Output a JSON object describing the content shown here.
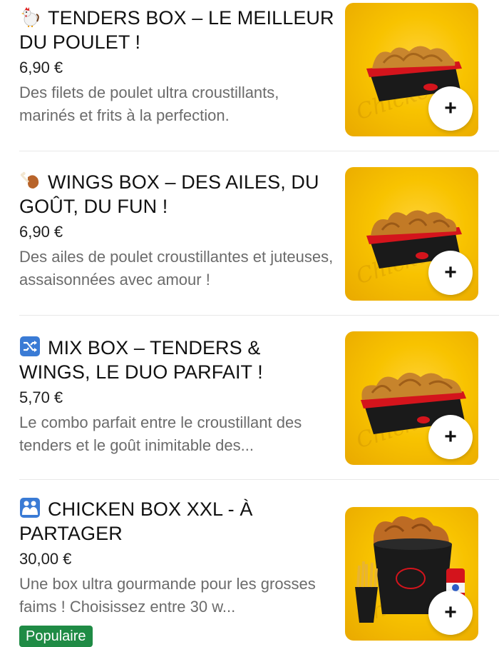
{
  "items": [
    {
      "title": "TENDERS BOX – LE MEILLEUR DU POULET !",
      "emoji": "rooster-emoji",
      "price": "6,90 €",
      "description": "Des filets de poulet ultra croustillants, marinés et frits à la perfection.",
      "image": "tenders-box-photo",
      "add_label": "+"
    },
    {
      "title": "WINGS BOX – DES AILES, DU GOÛT, DU FUN !",
      "emoji": "drumstick-emoji",
      "price": "6,90 €",
      "description": "Des ailes de poulet croustillantes et juteuses, assaisonnées avec amour !",
      "image": "wings-box-photo",
      "add_label": "+"
    },
    {
      "title": "MIX BOX – TENDERS & WINGS, LE DUO PARFAIT !",
      "emoji": "shuffle-emoji",
      "price": "5,70 €",
      "description": "Le combo parfait entre le croustillant des tenders et le goût inimitable des...",
      "image": "mix-box-photo",
      "add_label": "+"
    },
    {
      "title": "CHICKEN BOX XXL - À PARTAGER",
      "emoji": "family-emoji",
      "price": "30,00 €",
      "description": "Une box ultra gourmande pour les grosses faims ! Choisissez entre 30 w...",
      "image": "chicken-bucket-photo",
      "add_label": "+",
      "badge": "Populaire"
    }
  ],
  "colors": {
    "thumb_bg": "#f8c300",
    "badge_bg": "#1f8b45",
    "box_red": "#d4141c",
    "box_black": "#1a1a1a"
  }
}
